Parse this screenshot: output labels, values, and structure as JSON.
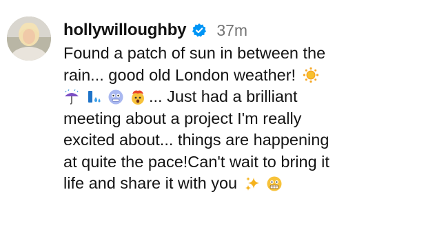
{
  "post": {
    "username": "hollywilloughby",
    "timestamp": "37m",
    "verified_icon": "verified-badge-icon",
    "accent_color": "#0095f6",
    "caption": {
      "line1": "Found a patch of sun in between the",
      "line2": "rain... good old London weather!",
      "line3": "... Just had a brilliant",
      "line4": "meeting about a project I'm really",
      "line5": "excited about... things are happening",
      "line6": "at quite the pace!Can't wait to bring it",
      "line7": "life and share it with you"
    },
    "emojis": [
      "sun-emoji",
      "umbrella-rain-emoji",
      "sweat-droplets-emoji",
      "cold-face-emoji",
      "exploding-head-emoji",
      "sparkles-emoji",
      "grimacing-face-emoji"
    ]
  }
}
